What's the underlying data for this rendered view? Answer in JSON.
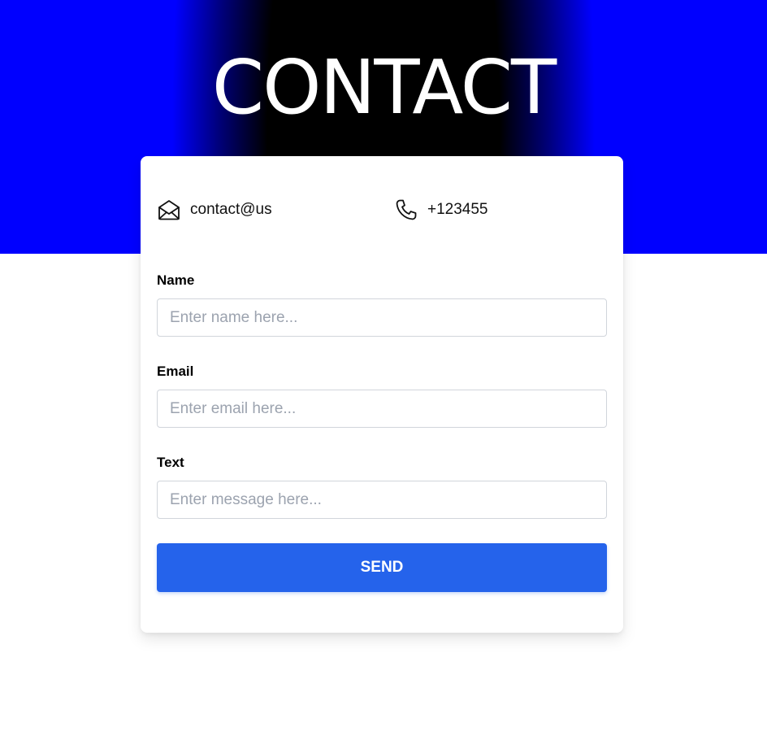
{
  "hero": {
    "title": "CONTACT",
    "gradient_colors": [
      "#0000ff",
      "#000000"
    ]
  },
  "contact_info": {
    "email": {
      "icon": "envelope-open-icon",
      "text": "contact@us"
    },
    "phone": {
      "icon": "phone-icon",
      "text": "+123455"
    }
  },
  "form": {
    "name": {
      "label": "Name",
      "placeholder": "Enter name here...",
      "value": ""
    },
    "email": {
      "label": "Email",
      "placeholder": "Enter email here...",
      "value": ""
    },
    "text": {
      "label": "Text",
      "placeholder": "Enter message here...",
      "value": ""
    },
    "submit_label": "SEND"
  },
  "colors": {
    "accent": "#2563eb",
    "input_border": "#d1d5db",
    "placeholder": "#9ca3af"
  }
}
